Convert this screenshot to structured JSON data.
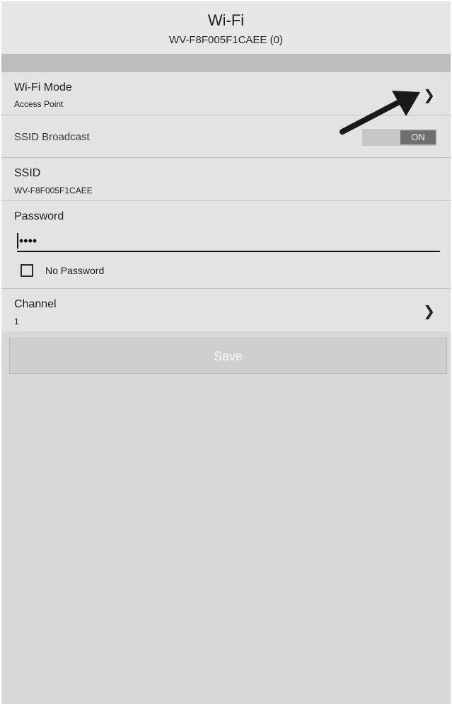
{
  "header": {
    "title": "Wi-Fi",
    "subtitle": "WV-F8F005F1CAEE (0)"
  },
  "wifi_mode": {
    "label": "Wi-Fi Mode",
    "value": "Access Point",
    "chevron": "chevron-right-icon"
  },
  "ssid_broadcast": {
    "label": "SSID Broadcast",
    "toggle_label": "ON",
    "enabled": true
  },
  "ssid": {
    "label": "SSID",
    "value": "WV-F8F005F1CAEE"
  },
  "password": {
    "label": "Password",
    "masked_value": "••••",
    "no_password_label": "No Password",
    "no_password_checked": false
  },
  "channel": {
    "label": "Channel",
    "value": "1",
    "chevron": "chevron-right-icon"
  },
  "actions": {
    "save_label": "Save"
  },
  "annotation": {
    "icon": "arrow-pointer-icon"
  },
  "colors": {
    "background": "#d8d8d8",
    "row": "#e3e3e3",
    "toggle_on": "#6f6f6f",
    "button_disabled": "#cfcfcf"
  }
}
